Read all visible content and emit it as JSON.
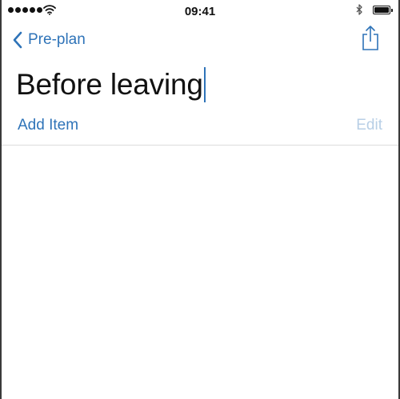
{
  "status_bar": {
    "time": "09:41",
    "signal_dots": 5,
    "icons": [
      "signal-dots-icon",
      "wifi-icon",
      "bluetooth-icon",
      "battery-icon"
    ],
    "battery_level": 1.0
  },
  "nav": {
    "back_label": "Pre-plan",
    "back_icon": "chevron-left-icon",
    "share_icon": "share-icon"
  },
  "title": {
    "value": "Before leaving"
  },
  "toolbar": {
    "add_item_label": "Add Item",
    "edit_label": "Edit"
  },
  "colors": {
    "accent": "#2e73b8",
    "disabled": "#b8cfe6",
    "text": "#111111",
    "divider": "#dcdcdc"
  }
}
